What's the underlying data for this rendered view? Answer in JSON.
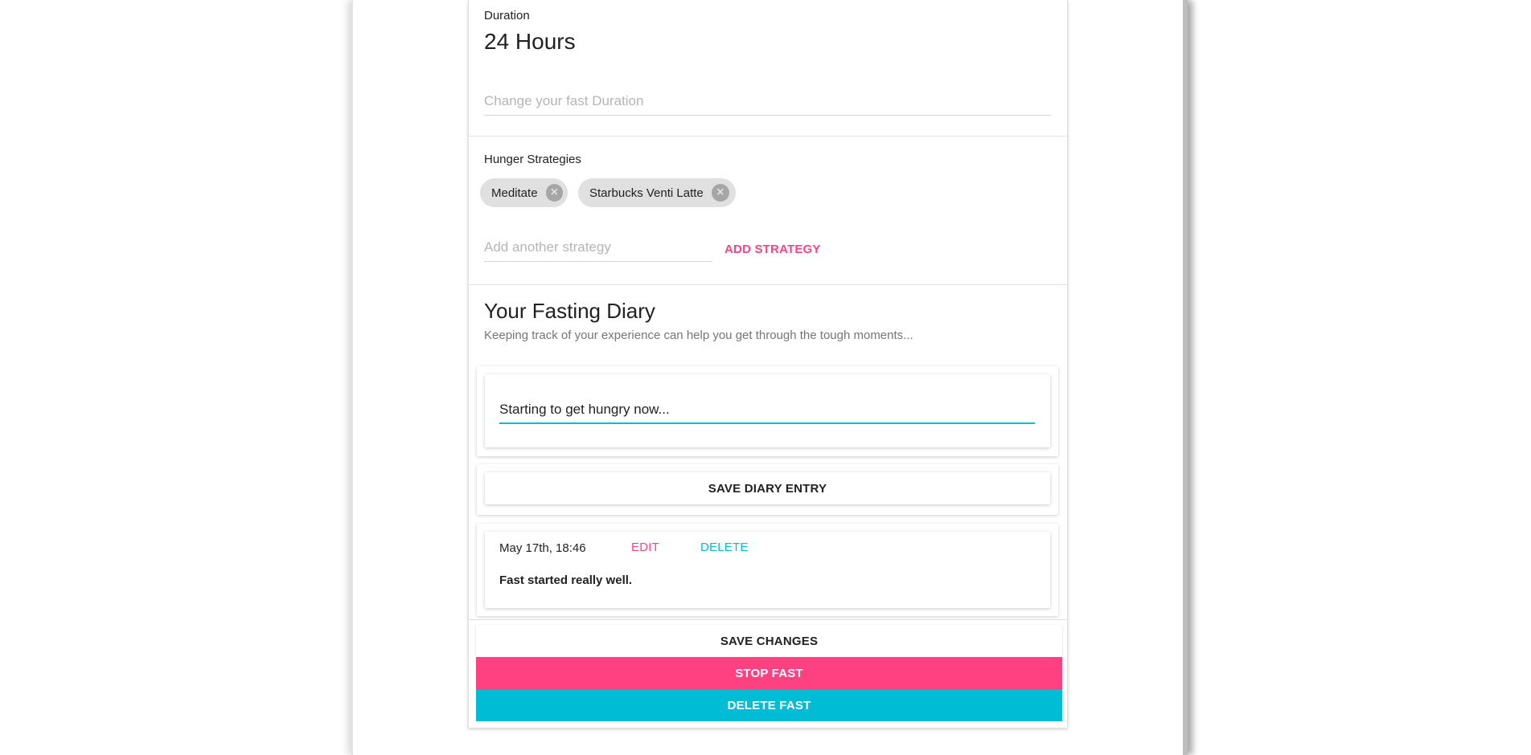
{
  "duration": {
    "label": "Duration",
    "value": "24 Hours",
    "input_placeholder": "Change your fast Duration"
  },
  "hunger": {
    "label": "Hunger Strategies",
    "chips": [
      "Meditate",
      "Starbucks Venti Latte"
    ],
    "input_placeholder": "Add another strategy",
    "add_label": "ADD STRATEGY"
  },
  "diary": {
    "title": "Your Fasting Diary",
    "subtitle": "Keeping track of your experience can help you get through the tough moments...",
    "entry_value": "Starting to get hungry now...",
    "save_label": "SAVE DIARY ENTRY",
    "entries": [
      {
        "date": "May 17th, 18:46",
        "edit_label": "EDIT",
        "delete_label": "DELETE",
        "text": "Fast started really well."
      }
    ]
  },
  "actions": {
    "save_changes": "SAVE CHANGES",
    "stop_fast": "STOP FAST",
    "delete_fast": "DELETE FAST"
  },
  "colors": {
    "accent_pink": "#ff4081",
    "accent_cyan": "#00bcd4"
  },
  "icons": {
    "chip_remove": "cancel-circle-icon"
  }
}
